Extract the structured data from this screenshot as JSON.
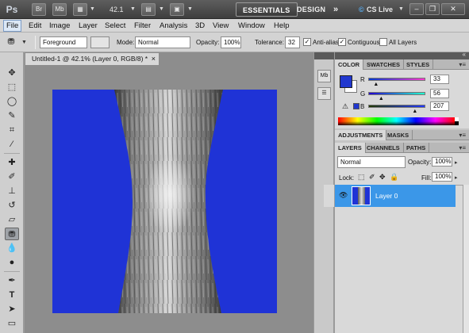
{
  "appbar": {
    "logo": "Ps",
    "br_label": "Br",
    "mb_label": "Mb",
    "zoom": "42.1",
    "workspace_essentials": "ESSENTIALS",
    "workspace_design": "DESIGN",
    "more": "»",
    "cslive": "CS Live"
  },
  "menu": [
    "File",
    "Edit",
    "Image",
    "Layer",
    "Select",
    "Filter",
    "Analysis",
    "3D",
    "View",
    "Window",
    "Help"
  ],
  "options": {
    "preset": "Foreground",
    "mode_label": "Mode:",
    "mode_value": "Normal",
    "opacity_label": "Opacity:",
    "opacity_value": "100%",
    "tolerance_label": "Tolerance:",
    "tolerance_value": "32",
    "antialias_label": "Anti-alias",
    "contiguous_label": "Contiguous",
    "alllayers_label": "All Layers"
  },
  "document": {
    "tab_title": "Untitled-1 @ 42.1% (Layer 0, RGB/8) *",
    "close": "×"
  },
  "color_panel": {
    "tabs": [
      "COLOR",
      "SWATCHES",
      "STYLES"
    ],
    "r_label": "R",
    "g_label": "G",
    "b_label": "B",
    "r_value": "33",
    "g_value": "56",
    "b_value": "207",
    "r_fraction": 0.13,
    "g_fraction": 0.22,
    "b_fraction": 0.81,
    "foreground_color": "#2138cf"
  },
  "adjustments_panel": {
    "tabs": [
      "ADJUSTMENTS",
      "MASKS"
    ]
  },
  "layers_panel": {
    "tabs": [
      "LAYERS",
      "CHANNELS",
      "PATHS"
    ],
    "blend_mode": "Normal",
    "opacity_label": "Opacity:",
    "opacity_value": "100%",
    "lock_label": "Lock:",
    "fill_label": "Fill:",
    "fill_value": "100%",
    "layer_name": "Layer 0"
  },
  "colors": {
    "canvas_bg": "#1f33d6",
    "layer_selected": "#3b97e8",
    "appbar": "#4a4a4a"
  }
}
